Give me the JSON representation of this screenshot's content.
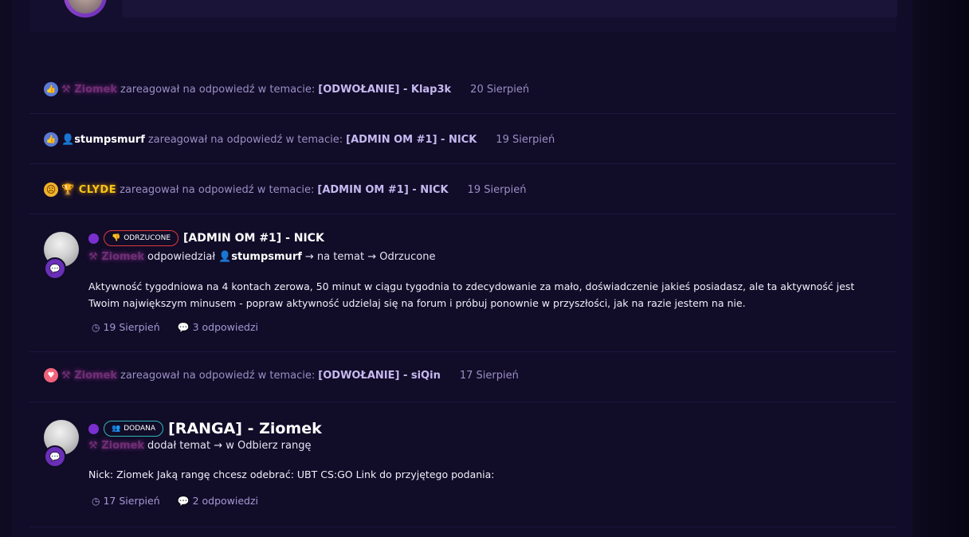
{
  "feed": {
    "rows": [
      {
        "user": "Ziomek",
        "action": "zareagował na odpowiedź w temacie:",
        "topic": "[ODWOŁANIE] - Klap3k",
        "date": "20 Sierpień"
      },
      {
        "user": "stumpsmurf",
        "action": "zareagował na odpowiedź w temacie:",
        "topic": "[ADMIN OM #1] - NICK",
        "date": "19 Sierpień"
      },
      {
        "user": "CLYDE",
        "action": "zareagował na odpowiedź w temacie:",
        "topic": "[ADMIN OM #1] - NICK",
        "date": "19 Sierpień"
      },
      {
        "user": "Ziomek",
        "action": "zareagował na odpowiedź w temacie:",
        "topic": "[ODWOŁANIE] - siQin",
        "date": "17 Sierpień"
      }
    ],
    "post1": {
      "tag": "ODRZUCONE",
      "title": "[ADMIN OM #1] - NICK",
      "author": "Ziomek",
      "verb": "odpowiedział",
      "target_user": "stumpsmurf",
      "arrow_text": "→ na temat → Odrzucone",
      "body": "Aktywność tygodniowa na 4 kontach zerowa, 50 minut w ciągu tygodnia to zdecydowanie za mało, doświadczenie jakieś posiadasz, ale ta aktywność jest Twoim największym minusem - popraw aktywność udzielaj się na forum i próbuj ponownie w przyszłości, jak na razie jestem na nie.",
      "date": "19 Sierpień",
      "replies": "3 odpowiedzi"
    },
    "post2": {
      "tag": "DODANA",
      "title": "[RANGA] - Ziomek",
      "author": "Ziomek",
      "verb": "dodał temat → w Odbierz rangę",
      "body": "Nick: Ziomek Jaką rangę chcesz odebrać: UBT CS:GO Link do przyjętego podania:",
      "date": "17 Sierpień",
      "replies": "2 odpowiedzi"
    }
  },
  "icons": [
    "like-icon",
    "heart-icon",
    "emoji-face-icon",
    "trophy-icon",
    "user-icon",
    "hammer-icon",
    "clock-icon",
    "comment-icon",
    "thumbs-down-icon",
    "group-icon"
  ],
  "colors": {
    "background": "#0b0818",
    "panel": "#110c28",
    "accent": "#7a2fd0",
    "rejected": "#e03a3a",
    "added": "#2fb9b5"
  }
}
